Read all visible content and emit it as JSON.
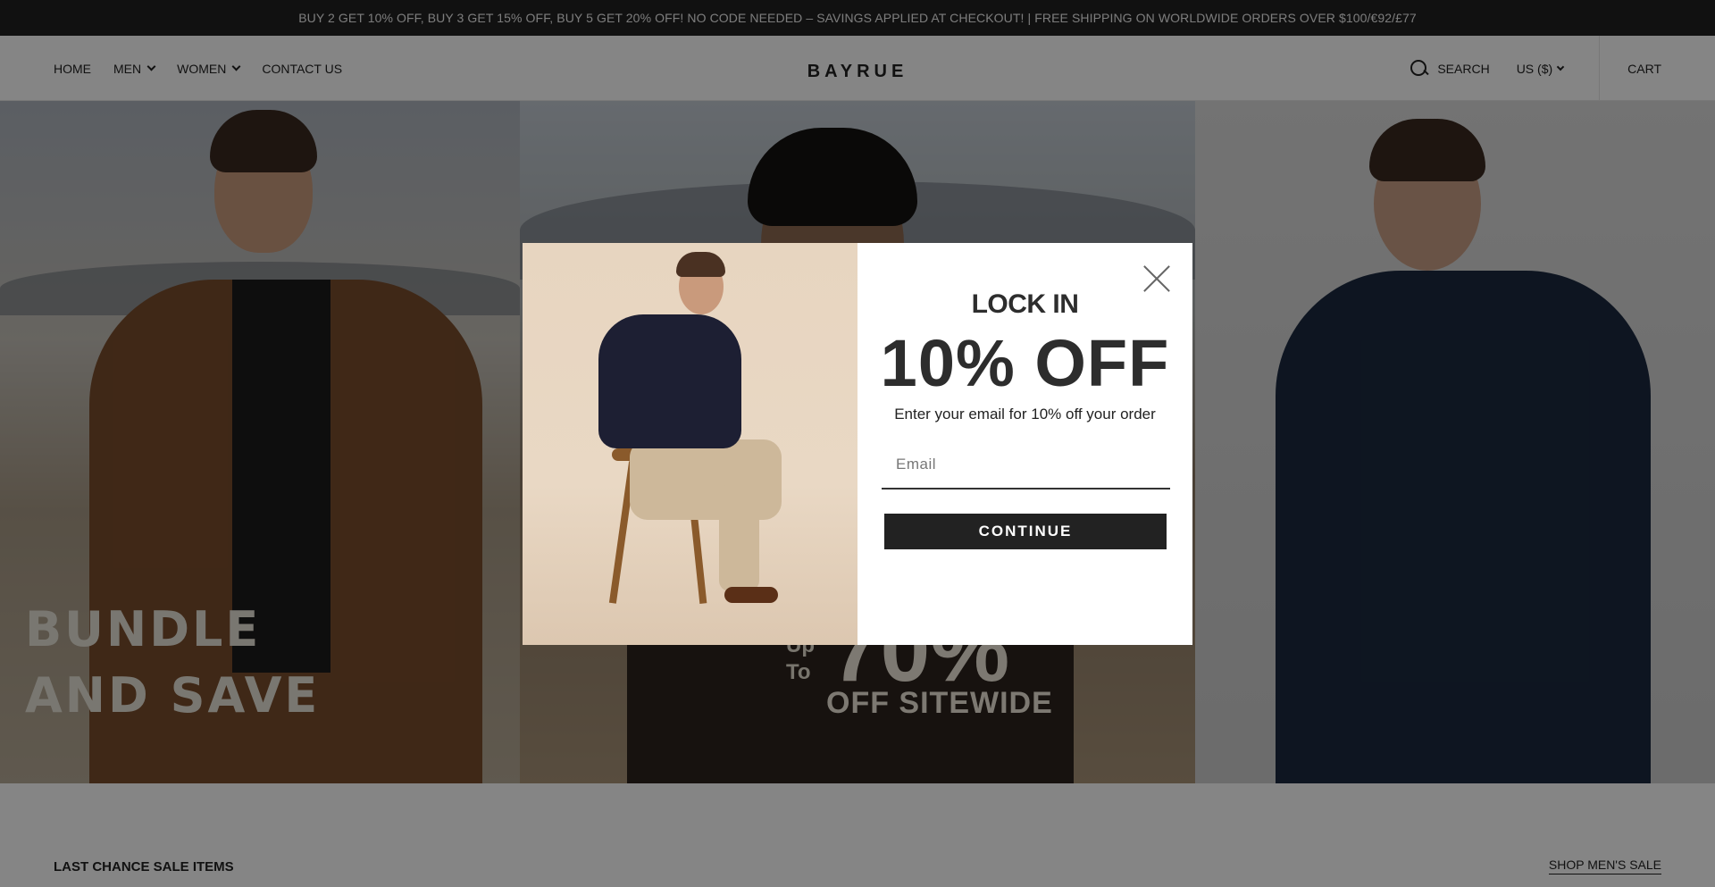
{
  "announcement": {
    "text": "BUY 2 GET 10% OFF, BUY 3 GET 15% OFF, BUY 5 GET 20% OFF! NO CODE NEEDED – SAVINGS APPLIED AT CHECKOUT! | FREE SHIPPING ON WORLDWIDE ORDERS OVER $100/€92/£77"
  },
  "header": {
    "nav": [
      {
        "label": "HOME",
        "has_dropdown": false
      },
      {
        "label": "MEN",
        "has_dropdown": true
      },
      {
        "label": "WOMEN",
        "has_dropdown": true
      },
      {
        "label": "CONTACT US",
        "has_dropdown": false
      }
    ],
    "logo": "BAYRUE",
    "search_label": "SEARCH",
    "currency_label": "US ($)",
    "cart_label": "CART",
    "icons": {
      "search": "search-icon",
      "chevron": "chevron-down-icon"
    }
  },
  "hero": {
    "left_text_line1": "BUNDLE",
    "left_text_line2": "AND SAVE",
    "center_up_line1": "Up",
    "center_up_line2": "To",
    "center_pct": "70%",
    "center_off": "OFF SITEWIDE"
  },
  "section": {
    "title": "LAST CHANCE SALE ITEMS",
    "link_label": "SHOP MEN'S SALE"
  },
  "modal": {
    "heading": "LOCK IN",
    "offer": "10% OFF",
    "subtext": "Enter your email for 10% off your order",
    "email_placeholder": "Email",
    "email_value": "",
    "button_label": "CONTINUE",
    "close_icon": "close-icon",
    "overlay_color": "#000000"
  },
  "colors": {
    "announcement_bg": "#222222",
    "button_bg": "#222222",
    "text_dark": "#2d2d2d"
  }
}
